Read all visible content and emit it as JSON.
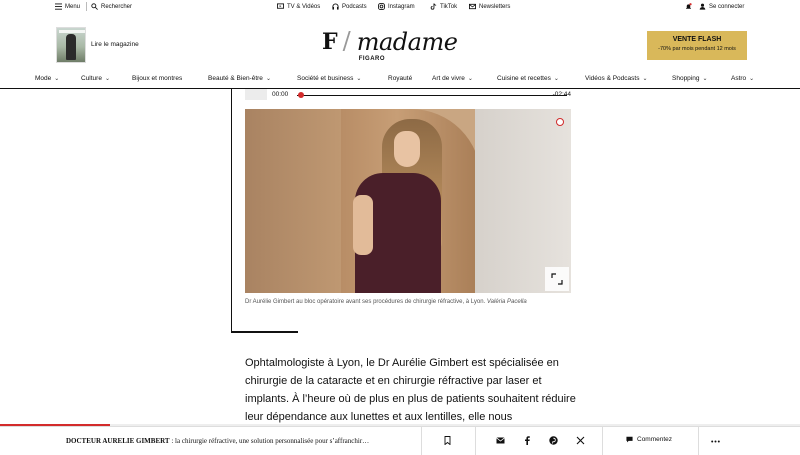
{
  "topbar": {
    "menu": "Menu",
    "search": "Rechercher",
    "tv": "TV & Vidéos",
    "podcasts": "Podcasts",
    "instagram": "Instagram",
    "tiktok": "TikTok",
    "newsletters": "Newsletters",
    "login": "Se connecter"
  },
  "header": {
    "magazine_label": "Lire le magazine",
    "logo_madame": "madame",
    "logo_figaro": "FIGARO",
    "promo_title": "VENTE FLASH",
    "promo_sub": "-70% par mois pendant 12 mois"
  },
  "nav": [
    {
      "label": "Mode",
      "dropdown": true
    },
    {
      "label": "Culture",
      "dropdown": true
    },
    {
      "label": "Bijoux et montres",
      "dropdown": false
    },
    {
      "label": "Beauté & Bien-être",
      "dropdown": true
    },
    {
      "label": "Société et business",
      "dropdown": true
    },
    {
      "label": "Royauté",
      "dropdown": false
    },
    {
      "label": "Art de vivre",
      "dropdown": true
    },
    {
      "label": "Cuisine et recettes",
      "dropdown": true
    },
    {
      "label": "Vidéos & Podcasts",
      "dropdown": true
    },
    {
      "label": "Shopping",
      "dropdown": true
    },
    {
      "label": "Astro",
      "dropdown": true
    }
  ],
  "audio": {
    "current": "00:00",
    "total": "-02:44",
    "progress": 0
  },
  "caption": {
    "text": "Dr Aurélie Gimbert au bloc opératoire avant ses procédures de chirurgie réfractive, à Lyon.",
    "credit": "Valéria Pacella"
  },
  "article": {
    "paragraph": "Ophtalmologiste à Lyon, le Dr Aurélie Gimbert est spécialisée en chirurgie de la cataracte et en chirurgie réfractive par laser et implants. À l’heure où de plus en plus de patients souhaitent réduire leur dépendance aux lunettes et aux lentilles, elle nous"
  },
  "reading_progress": 0.137,
  "bottombar": {
    "title_bold": "DOCTEUR AURELIE GIMBERT",
    "title_rest": " : la chirurgie réfractive, une solution personnalisée pour s’affranchir…",
    "comment": "Commentez"
  },
  "colors": {
    "accent_red": "#d32b2b",
    "promo_gold": "#d9b85a"
  }
}
